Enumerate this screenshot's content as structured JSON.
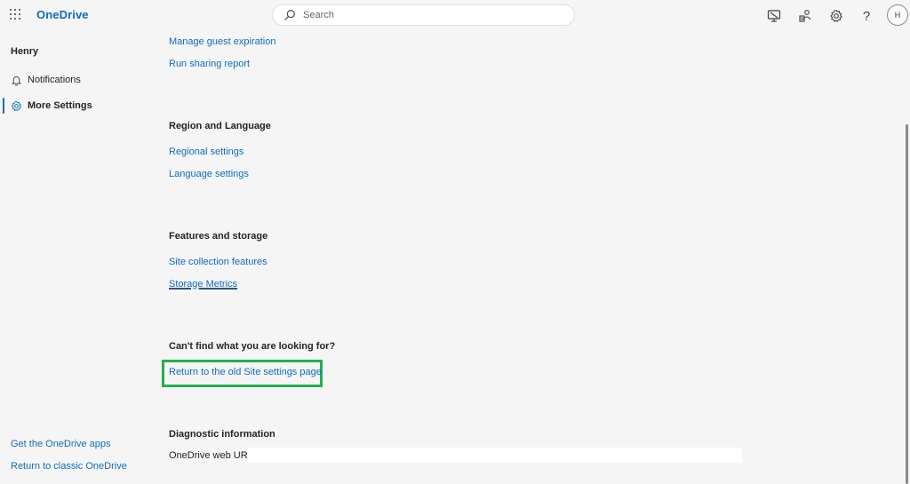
{
  "header": {
    "brand": "OneDrive",
    "search_placeholder": "Search",
    "icons": [
      "app-launcher-icon",
      "monitor-icon",
      "share-people-icon",
      "gear-icon",
      "help-icon"
    ],
    "help_glyph": "?",
    "avatar_initial": "H"
  },
  "sidebar": {
    "user": "Henry",
    "items": [
      {
        "label": "Notifications",
        "icon": "bell-icon"
      },
      {
        "label": "More Settings",
        "icon": "gear-icon"
      }
    ],
    "footer_links": [
      "Get the OneDrive apps",
      "Return to classic OneDrive"
    ]
  },
  "main": {
    "links_top": [
      "Manage guest expiration",
      "Run sharing report"
    ],
    "sections": [
      {
        "heading": "Region and Language",
        "links": [
          "Regional settings",
          "Language settings"
        ]
      },
      {
        "heading": "Features and storage",
        "links": [
          "Site collection features",
          "Storage Metrics"
        ]
      },
      {
        "heading": "Can't find what you are looking for?",
        "links": [
          "Return to the old Site settings page"
        ]
      }
    ],
    "diagnostic": {
      "heading": "Diagnostic information",
      "url_label": "OneDrive web URL:",
      "url_value": ""
    }
  },
  "colors": {
    "accent": "#0f6cbd",
    "highlight": "#22b14c",
    "background": "#f5f5f5"
  }
}
